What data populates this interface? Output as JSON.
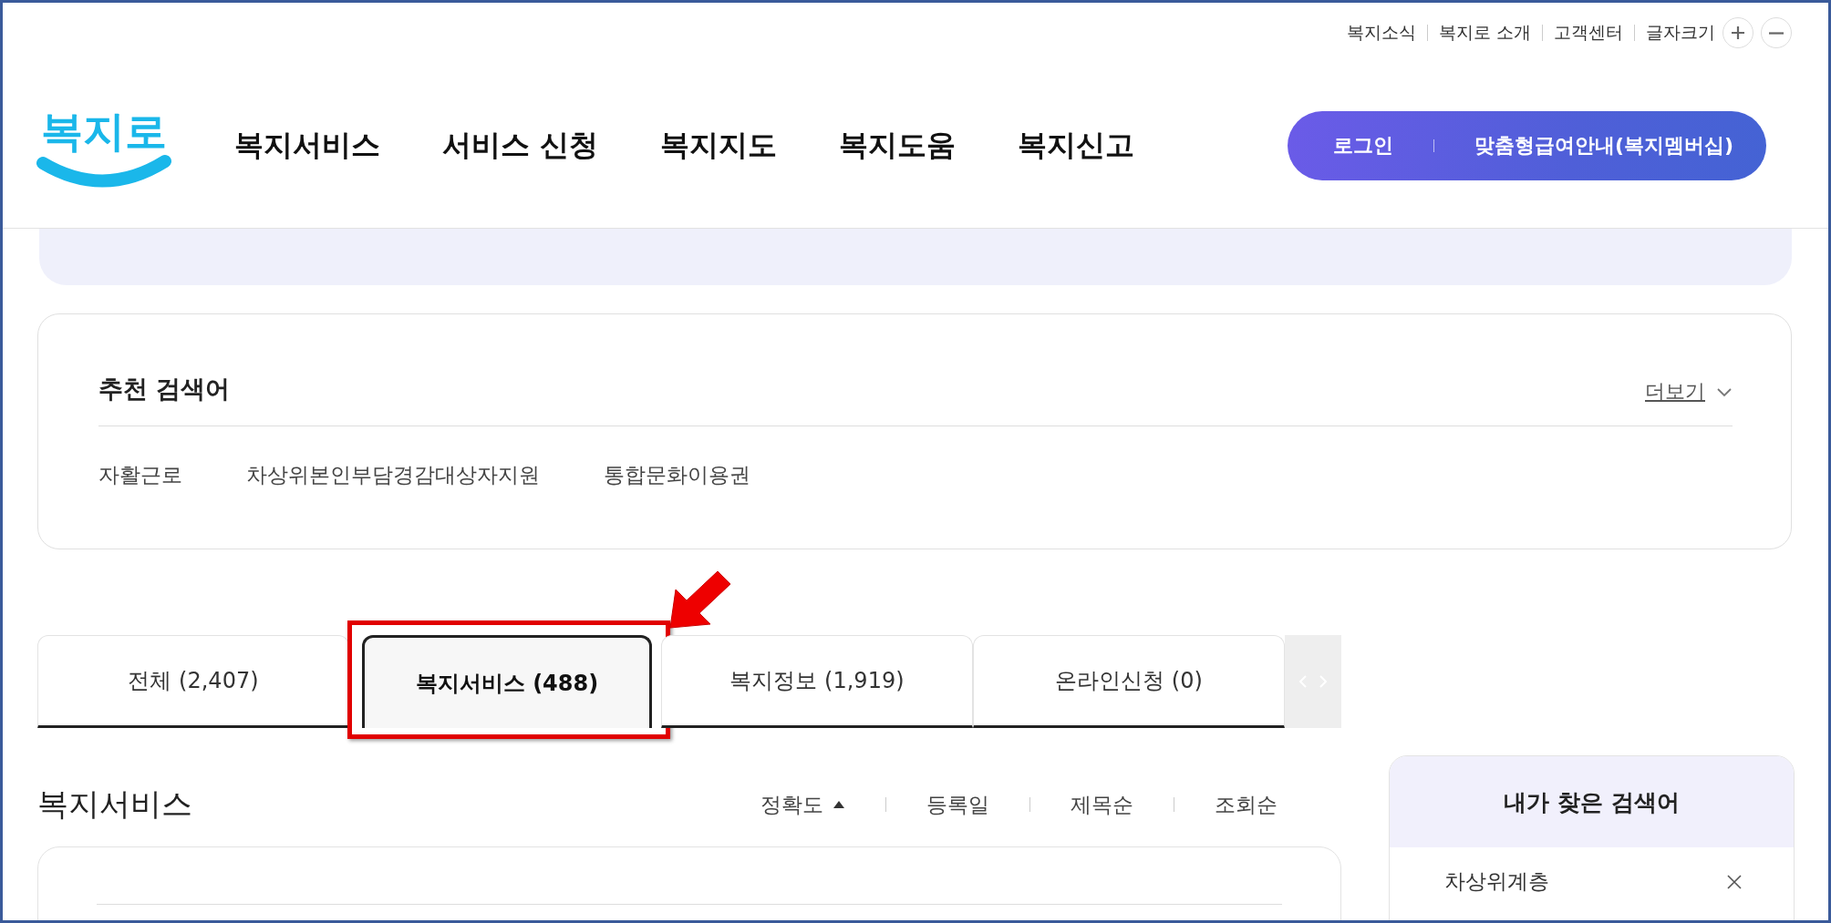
{
  "utility_links": [
    {
      "label": "복지소식"
    },
    {
      "label": "복지로 소개"
    },
    {
      "label": "고객센터"
    },
    {
      "label": "글자크기"
    }
  ],
  "logo": {
    "text": "복지로"
  },
  "nav": [
    {
      "label": "복지서비스"
    },
    {
      "label": "서비스 신청"
    },
    {
      "label": "복지지도"
    },
    {
      "label": "복지도움"
    },
    {
      "label": "복지신고"
    }
  ],
  "account_buttons": [
    {
      "label": "로그인"
    },
    {
      "label": "맞춤형급여안내(복지멤버십)"
    }
  ],
  "recommended": {
    "title": "추천 검색어",
    "more": "더보기",
    "keywords": [
      {
        "label": "자활근로"
      },
      {
        "label": "차상위본인부담경감대상자지원"
      },
      {
        "label": "통합문화이용권"
      }
    ]
  },
  "tabs": [
    {
      "label": "전체  (2,407)",
      "selected": false,
      "highlighted": false
    },
    {
      "label": "복지서비스 (488)",
      "selected": true,
      "highlighted": true
    },
    {
      "label": "복지정보 (1,919)",
      "selected": false,
      "highlighted": false
    },
    {
      "label": "온라인신청 (0)",
      "selected": false,
      "highlighted": false
    }
  ],
  "results": {
    "title": "복지서비스",
    "sort_options": [
      {
        "label": "정확도",
        "selected": true
      },
      {
        "label": "등록일",
        "selected": false
      },
      {
        "label": "제목순",
        "selected": false
      },
      {
        "label": "조회순",
        "selected": false
      }
    ]
  },
  "recent_searches": {
    "title": "내가 찾은 검색어",
    "items": [
      {
        "label": "차상위계층"
      }
    ]
  }
}
